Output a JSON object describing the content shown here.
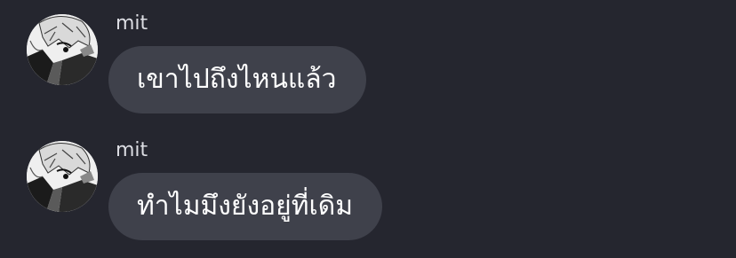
{
  "messages": [
    {
      "sender": "mit",
      "text": "เขาไปถึงไหนแล้ว",
      "avatar_icon": "manga-character-avatar-icon"
    },
    {
      "sender": "mit",
      "text": "ทำไมมึงยังอยู่ที่เดิม",
      "avatar_icon": "manga-character-avatar-icon"
    }
  ],
  "colors": {
    "background": "#25262f",
    "bubble": "#3f414b",
    "name_text": "#dcdde3",
    "message_text": "#ffffff"
  }
}
